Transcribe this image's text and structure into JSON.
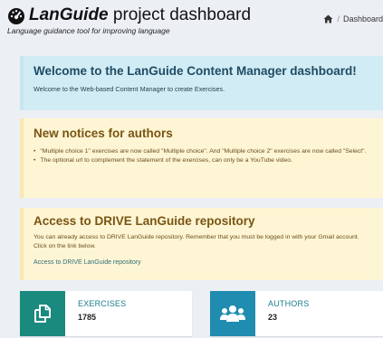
{
  "header": {
    "brand": "LanGuide",
    "title_rest": " project dashboard",
    "subtitle": "Language guidance tool for improving language",
    "breadcrumb": {
      "separator": "/",
      "current": "Dashboard"
    }
  },
  "welcome": {
    "title": "Welcome to the LanGuide Content Manager dashboard!",
    "text": "Welcome to the Web-based Content Manager to create Exercises."
  },
  "notices": {
    "title": "New notices for authors",
    "items": [
      "\"Multiple choice 1\" exercises are now called \"Multiple choice\". And \"Multiple choice 2\" exercises are now called \"Select\".",
      "The optional url to complement the statement of the exercises, can only be a YouTube video."
    ]
  },
  "drive": {
    "title": "Access to DRIVE LanGuide repository",
    "text": "You can already access to DRIVE LanGuide repository. Remember that you must be logged in with your Gmail account. Click on the link below.",
    "link": "Access to DRIVE LanGuide repository"
  },
  "stats": [
    {
      "label": "EXERCISES",
      "count": "1785",
      "icon": "copy-icon",
      "color": "#1a8a7e"
    },
    {
      "label": "AUTHORS",
      "count": "23",
      "icon": "users-icon",
      "color": "#1f8cb0"
    }
  ]
}
